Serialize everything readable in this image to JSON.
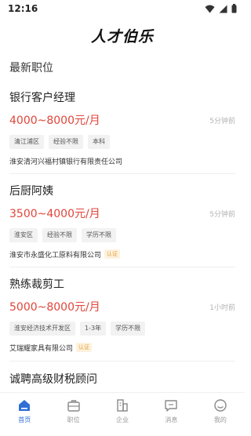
{
  "status_bar": {
    "time": "12:16"
  },
  "header": {
    "brand": "人才伯乐"
  },
  "section_title": "最新职位",
  "jobs": [
    {
      "title": "银行客户经理",
      "salary": "4000~8000元/月",
      "posted": "5分钟前",
      "tags": [
        "清江浦区",
        "经验不限",
        "本科"
      ],
      "company": "淮安清河兴福村镇银行有限责任公司",
      "badge": ""
    },
    {
      "title": "后厨阿姨",
      "salary": "3500~4000元/月",
      "posted": "5分钟前",
      "tags": [
        "淮安区",
        "经验不限",
        "学历不限"
      ],
      "company": "淮安市永盛化工原料有限公司",
      "badge": "认证"
    },
    {
      "title": "熟练裁剪工",
      "salary": "5000~8000元/月",
      "posted": "1小时前",
      "tags": [
        "淮安经济技术开发区",
        "1-3年",
        "学历不限"
      ],
      "company": "艾瑞耀家具有限公司",
      "badge": "认证"
    },
    {
      "title": "诚聘高级财税顾问"
    }
  ],
  "tabbar": {
    "items": [
      {
        "label": "首页",
        "icon": "home-icon",
        "active": true
      },
      {
        "label": "职位",
        "icon": "briefcase-icon",
        "active": false
      },
      {
        "label": "企业",
        "icon": "building-icon",
        "active": false
      },
      {
        "label": "消息",
        "icon": "message-icon",
        "active": false
      },
      {
        "label": "我的",
        "icon": "profile-icon",
        "active": false
      }
    ]
  },
  "colors": {
    "accent": "#2f6fd6",
    "salary": "#e0453a",
    "badge": "#e8a23c"
  }
}
